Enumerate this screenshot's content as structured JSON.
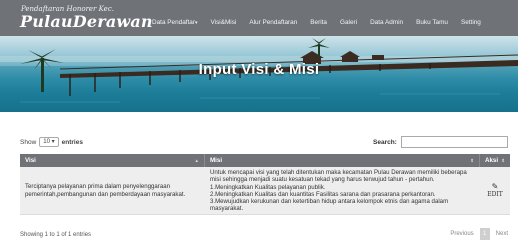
{
  "header": {
    "subtitle": "Pendaftaran Honorer Kec.",
    "title": "PulauDerawan",
    "nav": [
      {
        "label": "Data Pendaftar",
        "caret": "▾"
      },
      {
        "label": "Visi&Misi"
      },
      {
        "label": "Alur Pendaftaran"
      },
      {
        "label": "Berita"
      },
      {
        "label": "Galeri"
      },
      {
        "label": "Data Admin"
      },
      {
        "label": "Buku Tamu"
      },
      {
        "label": "Setting"
      }
    ]
  },
  "hero": {
    "title": "Input Visi & Misi"
  },
  "controls": {
    "show_label": "Show",
    "entries_value": "10",
    "entries_label": "entries",
    "search_label": "Search:"
  },
  "table": {
    "columns": [
      "Visi",
      "Misi",
      "Aksi"
    ],
    "rows": [
      {
        "visi": "Terciptanya pelayanan prima dalam penyelenggaraan pemerintah,pembangunan dan pemberdayaan masyarakat.",
        "misi": [
          "Untuk mencapai visi yang telah ditentukan maka kecamatan Pulau Derawan memiliki beberapa misi sehingga menjadi suatu kesatuan tekad yang harus terwujud tahun - pertahun.",
          "1.Meningkatkan Kualitas pelayanan publik.",
          "2.Meningkatkan Kualitas dan kuantitas Fasilitas sarana dan prasarana perkantoran.",
          "3.Mewujudkan kerukunan dan ketertiban hidup antara kelompok etnis dan agama dalam masyarakat."
        ],
        "action": "EDIT"
      }
    ]
  },
  "footer": {
    "info": "Showing 1 to 1 of 1 entries",
    "previous": "Previous",
    "page": "1",
    "next": "Next"
  },
  "icons": {
    "edit": "edit-icon",
    "sort": "sort-icon"
  },
  "colors": {
    "header_bg": "#6f7277",
    "table_header_bg": "#6f7277",
    "row_bg": "#eeeeee"
  }
}
